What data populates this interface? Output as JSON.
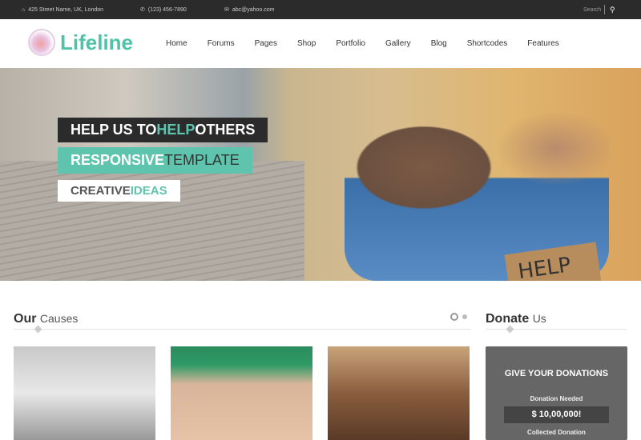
{
  "topbar": {
    "address": "425 Street Name, UK, London",
    "phone": "(123) 456-7890",
    "email": "abc@yahoo.com",
    "search": "Search"
  },
  "logo": {
    "text": "Lifeline"
  },
  "nav": [
    "Home",
    "Forums",
    "Pages",
    "Shop",
    "Portfolio",
    "Gallery",
    "Blog",
    "Shortcodes",
    "Features"
  ],
  "hero": {
    "line1_a": "HELP US TO ",
    "line1_b": "HELP",
    "line1_c": " OTHERS",
    "line2_a": "RESPONSIVE ",
    "line2_b": "TEMPLATE",
    "line3_a": "CREATIVE ",
    "line3_b": "IDEAS",
    "sign": "HELP ME"
  },
  "causes": {
    "title_bold": "Our",
    "title_rest": "Causes"
  },
  "donate": {
    "title_bold": "Donate",
    "title_rest": "Us",
    "box_title": "GIVE YOUR DONATIONS",
    "needed_label": "Donation Needed",
    "needed_amount": "$ 10,00,000!",
    "collected_label": "Collected Donation"
  },
  "colors": {
    "accent": "#5ec4ae",
    "dark": "#2b2b2b"
  }
}
